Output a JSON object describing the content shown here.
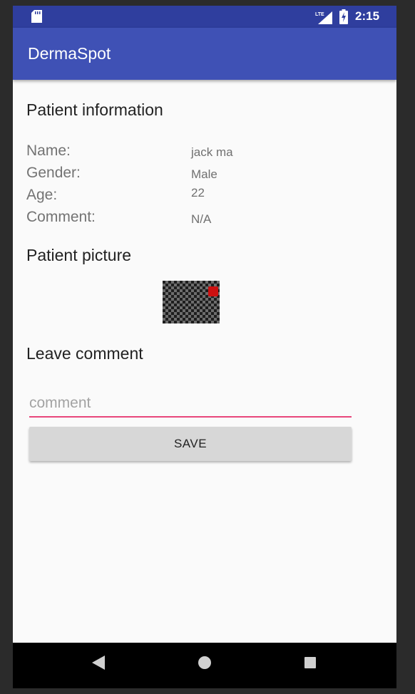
{
  "status_bar": {
    "time": "2:15",
    "network": "LTE",
    "icons": [
      "sd-card-icon",
      "lte-signal-icon",
      "battery-charging-icon"
    ]
  },
  "app_bar": {
    "title": "DermaSpot"
  },
  "patient_information": {
    "heading": "Patient information",
    "fields": [
      {
        "label": "Name:",
        "value": "jack ma"
      },
      {
        "label": "Gender:",
        "value": "Male"
      },
      {
        "label": "Age:",
        "value": "22"
      },
      {
        "label": "Comment:",
        "value": "N/A"
      }
    ]
  },
  "patient_picture": {
    "heading": "Patient picture"
  },
  "leave_comment": {
    "heading": "Leave comment",
    "input_value": "",
    "placeholder": "comment",
    "save_label": "SAVE"
  },
  "colors": {
    "status_bar": "#2f3e9e",
    "app_bar": "#3f51b5",
    "input_underline": "#e8457a",
    "button": "#d7d7d7"
  },
  "nav_bar": {
    "icons": [
      "back-icon",
      "home-icon",
      "recent-apps-icon"
    ]
  }
}
